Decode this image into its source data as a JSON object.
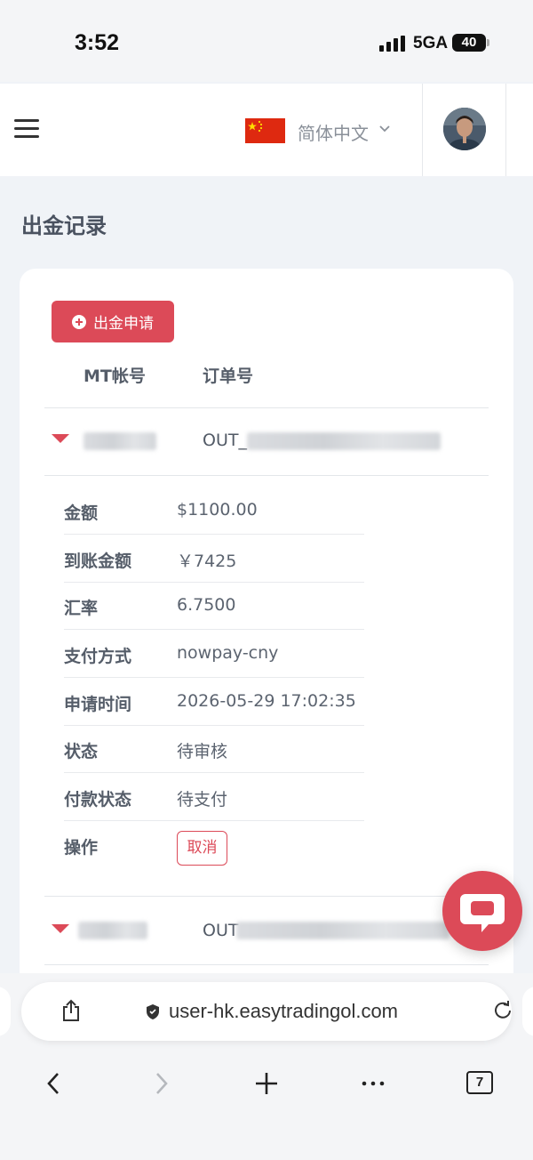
{
  "status_bar": {
    "time": "3:52",
    "network": "5GA",
    "battery": "40"
  },
  "header": {
    "language": "简体中文"
  },
  "page": {
    "title": "出金记录"
  },
  "toolbar": {
    "apply_label": "出金申请"
  },
  "table": {
    "columns": [
      "MT帐号",
      "订单号"
    ]
  },
  "rows": [
    {
      "order_prefix": "OUT_"
    },
    {
      "order_prefix": "OUT"
    }
  ],
  "details": [
    {
      "label": "金额",
      "value": "$1100.00"
    },
    {
      "label": "到账金额",
      "value": "￥7425"
    },
    {
      "label": "汇率",
      "value": "6.7500"
    },
    {
      "label": "支付方式",
      "value": "nowpay-cny"
    },
    {
      "label": "申请时间",
      "value": "2026-05-29 17:02:35"
    },
    {
      "label": "状态",
      "value": "待审核"
    },
    {
      "label": "付款状态",
      "value": "待支付"
    },
    {
      "label": "操作",
      "value": ""
    }
  ],
  "actions": {
    "cancel_label": "取消"
  },
  "browser": {
    "url": "user-hk.easytradingol.com",
    "tab_count": "7"
  },
  "colors": {
    "accent": "#dc4a58",
    "background": "#f0f3f7"
  }
}
